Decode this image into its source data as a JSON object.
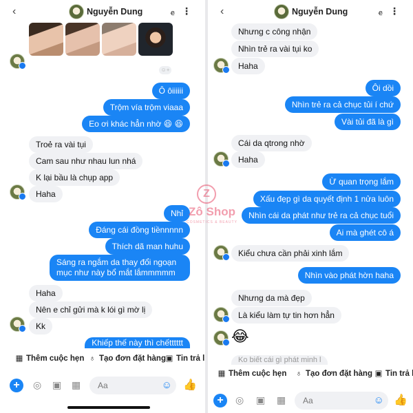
{
  "contact_name": "Nguyễn Dung",
  "icons": {
    "back": "‹",
    "call": "ꬳ",
    "more": "⋮",
    "plus": "+",
    "camera": "◎",
    "gallery": "▣",
    "sticker": "▦",
    "emoji": "☺",
    "like": "👍"
  },
  "left": {
    "reaction_icon": "☺+",
    "messages": [
      "Ô ôiiiiii",
      "Trộm vía trộm viaaa",
      "Eo ơi khác hẳn nhờ 😆 😆",
      "Troẻ ra vài tụi",
      "Cam sau như nhau lun nhá",
      "K lại bầu là chụp app",
      "Haha",
      "Nhỉ",
      "Đáng cái đồng tiềnnnnn",
      "Thích dã man huhu",
      "Sáng ra ngắm da thay đổi ngoạn mục như này bổ mắt lắmmmmm",
      "Haha",
      "Nên e chỉ gửi mà k lói gì mờ lị",
      "Kk",
      "Khiếp thế này thì chếtttttt"
    ],
    "chips": [
      "Thêm cuộc hẹn",
      "Tạo đơn đặt hàng",
      "Tin trả l"
    ]
  },
  "right": {
    "messages": [
      "Nhưng c công nhận",
      "Nhìn trẻ ra vài tụi ko",
      "Haha",
      "Ôi dồi",
      "Nhìn trẻ ra cả chục tủi í chứ",
      "Vài tủi đã là gì",
      "Cái da qtrong nhờ",
      "Haha",
      "Ừ quan trọng lắm",
      "Xấu đẹp gì da quyết định 1 nửa luôn",
      "Nhìn cái da phát như trẻ ra cả chục tuổi",
      "Ai mà ghét cô á",
      "Kiểu chưa cần phải xinh lắm",
      "Nhìn vào phát hờn haha",
      "Nhưng da mà đẹp",
      "Là kiểu làm tự tin hơn hẳn",
      "😂",
      "Ko biết cái gì phát minh l"
    ],
    "chips": [
      "Thêm cuộc hẹn",
      "Tạo đơn đặt hàng",
      "Tin trả l"
    ]
  },
  "composer_placeholder": "Aa",
  "watermark": {
    "logo": "Z",
    "name": "Zô Shop",
    "tagline": "COSMETICS & BEAUTY"
  }
}
